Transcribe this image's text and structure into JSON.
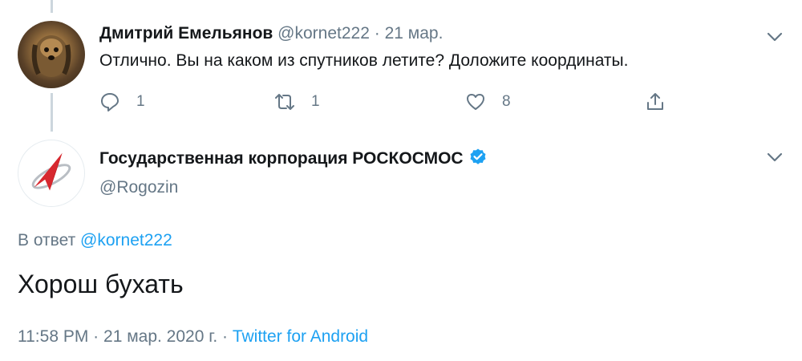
{
  "reply_tweet": {
    "author_name": "Дмитрий Емельянов",
    "handle": "@kornet222",
    "separator": "·",
    "date": "21 мар.",
    "text": "Отлично. Вы на каком из спутников летите? Доложите координаты.",
    "reply_count": "1",
    "retweet_count": "1",
    "like_count": "8"
  },
  "main_tweet": {
    "author_name": "Государственная корпорация РОСКОСМОС",
    "handle": "@Rogozin",
    "reply_prefix": "В ответ",
    "reply_mention": "@kornet222",
    "text": "Хорош бухать",
    "time": "11:58 PM",
    "separator": "·",
    "full_date": "21 мар. 2020 г.",
    "source": "Twitter for Android"
  },
  "icons": {
    "chevron": "chevron-down-icon",
    "reply": "reply-icon",
    "retweet": "retweet-icon",
    "like": "heart-icon",
    "share": "share-icon",
    "verified": "verified-badge-icon"
  },
  "colors": {
    "link": "#1da1f2",
    "muted": "#657786",
    "text": "#14171a",
    "logo_red": "#d7282f"
  }
}
